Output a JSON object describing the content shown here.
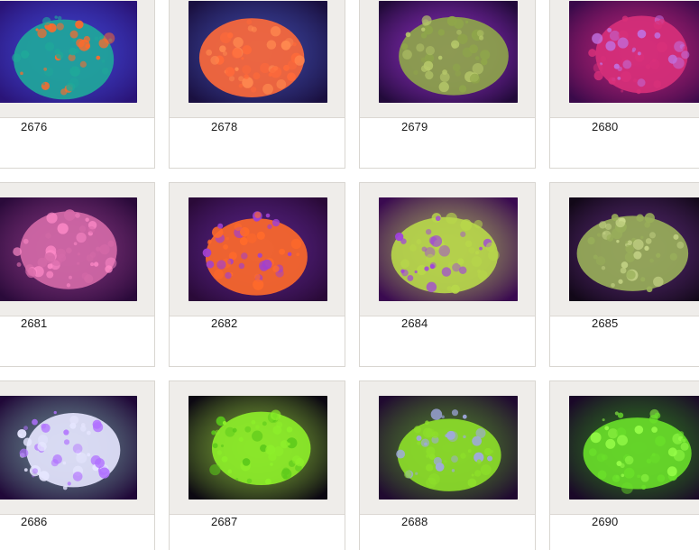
{
  "items": [
    {
      "number": "2676",
      "photo": "green-and-orange-ricordea-mushroom-photo",
      "bg": "#2a1478",
      "tones": [
        "#1fa89a",
        "#ff6a2a",
        "#4a5cff"
      ]
    },
    {
      "number": "2678",
      "photo": "orange-ricordea-mushroom-photo",
      "bg": "#1a1040",
      "tones": [
        "#ff6a3a",
        "#ff8a50",
        "#4f63d8"
      ]
    },
    {
      "number": "2679",
      "photo": "green-zoanthid-colony-photo",
      "bg": "#220a3a",
      "tones": [
        "#8fa64a",
        "#b6c86a",
        "#c040ff"
      ]
    },
    {
      "number": "2680",
      "photo": "pink-ricordea-mushroom-photo",
      "bg": "#3a0a4a",
      "tones": [
        "#d8307a",
        "#c070e0",
        "#ff3090"
      ]
    },
    {
      "number": "2681",
      "photo": "pink-mushroom-coral-photo",
      "bg": "#2a0a3a",
      "tones": [
        "#d56aa8",
        "#ff8ac8",
        "#b04aa0"
      ]
    },
    {
      "number": "2682",
      "photo": "orange-mushroom-coral-photo",
      "bg": "#2a0a38",
      "tones": [
        "#ff6a2a",
        "#a040d0",
        "#7030b0"
      ]
    },
    {
      "number": "2684",
      "photo": "green-polyps-on-purple-rock-photo",
      "bg": "#3a0a50",
      "tones": [
        "#b8d84a",
        "#a040e0",
        "#d8f06a"
      ]
    },
    {
      "number": "2685",
      "photo": "green-zoanthid-colony-on-rock-photo",
      "bg": "#120818",
      "tones": [
        "#9ab05a",
        "#c9d88a",
        "#7a3aa0"
      ]
    },
    {
      "number": "2686",
      "photo": "white-mushroom-coral-with-tentacles-photo",
      "bg": "#200838",
      "tones": [
        "#e6e6ff",
        "#b070ff",
        "#90d0c0"
      ]
    },
    {
      "number": "2687",
      "photo": "lime-green-toadstool-coral-photo",
      "bg": "#0c0812",
      "tones": [
        "#8ef02a",
        "#5ac81a",
        "#b8ff4a"
      ]
    },
    {
      "number": "2688",
      "photo": "lime-green-leather-coral-photo",
      "bg": "#200a30",
      "tones": [
        "#8ee02a",
        "#a0a8e0",
        "#6ac02a"
      ]
    },
    {
      "number": "2690",
      "photo": "green-toadstool-coral-photo",
      "bg": "#1a0828",
      "tones": [
        "#6ae02a",
        "#98ff4a",
        "#3ab01a"
      ]
    }
  ]
}
